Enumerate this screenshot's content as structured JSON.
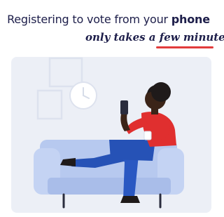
{
  "headline": {
    "text": "Registering to vote from your",
    "emphasis": "phone"
  },
  "subline": {
    "text": "only takes a few minutes"
  },
  "colors": {
    "navy": "#1d1e4a",
    "accent_red": "#e23c3c",
    "panel_bg": "#eceff6",
    "sofa_blue": "#b7c9ef",
    "pants_blue": "#2652b6",
    "shirt_red": "#e02f2f",
    "skin": "#3b2418"
  }
}
